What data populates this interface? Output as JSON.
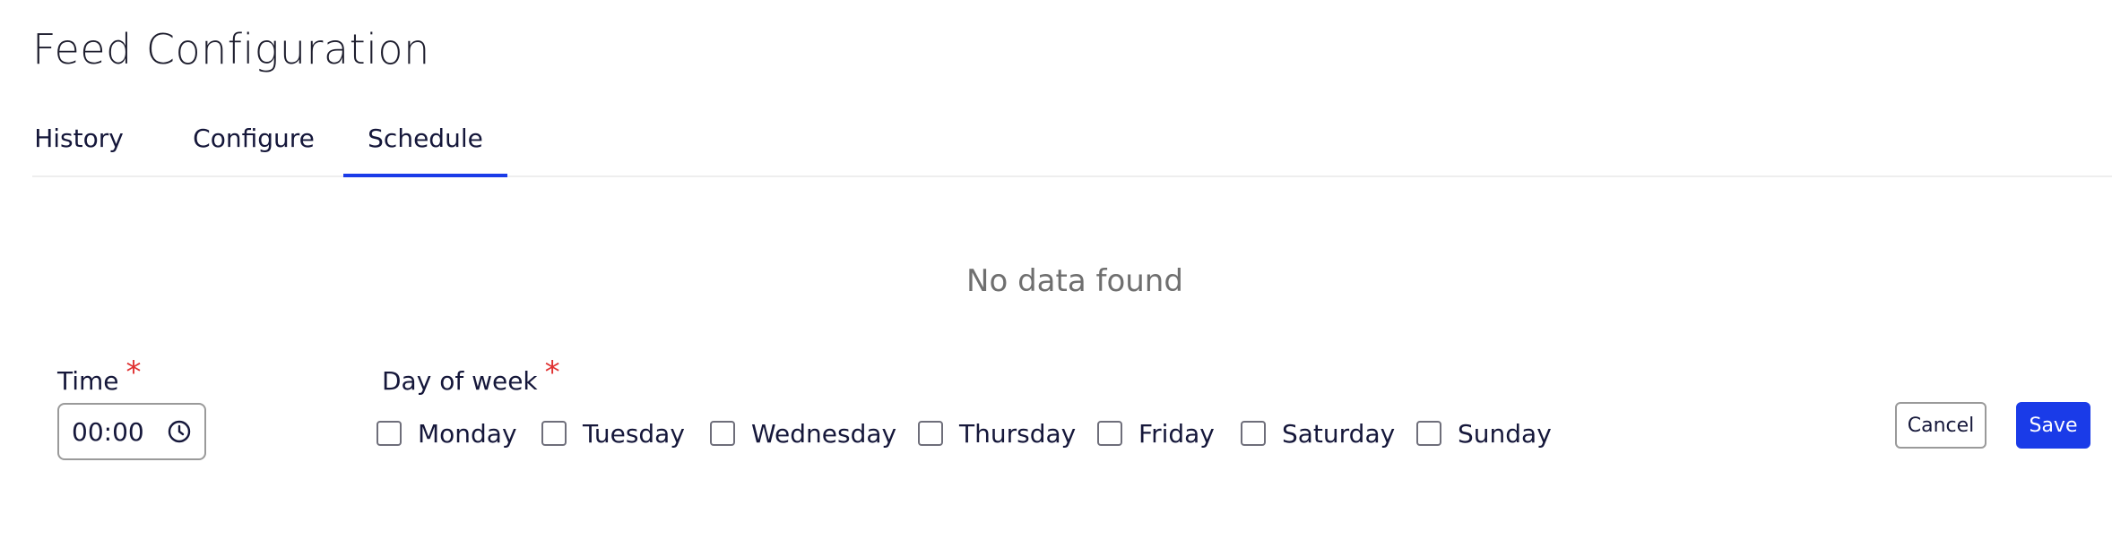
{
  "page": {
    "title": "Feed Configuration"
  },
  "tabs": [
    {
      "label": "History",
      "active": false
    },
    {
      "label": "Configure",
      "active": false
    },
    {
      "label": "Schedule",
      "active": true
    }
  ],
  "empty_state": {
    "message": "No data found"
  },
  "form": {
    "time_label": "Time",
    "required_mark": "*",
    "time_value": "00:00",
    "time_icon": "clock-icon",
    "day_label": "Day of week",
    "days": [
      {
        "label": "Monday",
        "checked": false
      },
      {
        "label": "Tuesday",
        "checked": false
      },
      {
        "label": "Wednesday",
        "checked": false
      },
      {
        "label": "Thursday",
        "checked": false
      },
      {
        "label": "Friday",
        "checked": false
      },
      {
        "label": "Saturday",
        "checked": false
      },
      {
        "label": "Sunday",
        "checked": false
      }
    ]
  },
  "actions": {
    "cancel_label": "Cancel",
    "save_label": "Save"
  },
  "colors": {
    "accent": "#1a3be8",
    "required": "#e03131",
    "muted_text": "#6f6f6f"
  }
}
